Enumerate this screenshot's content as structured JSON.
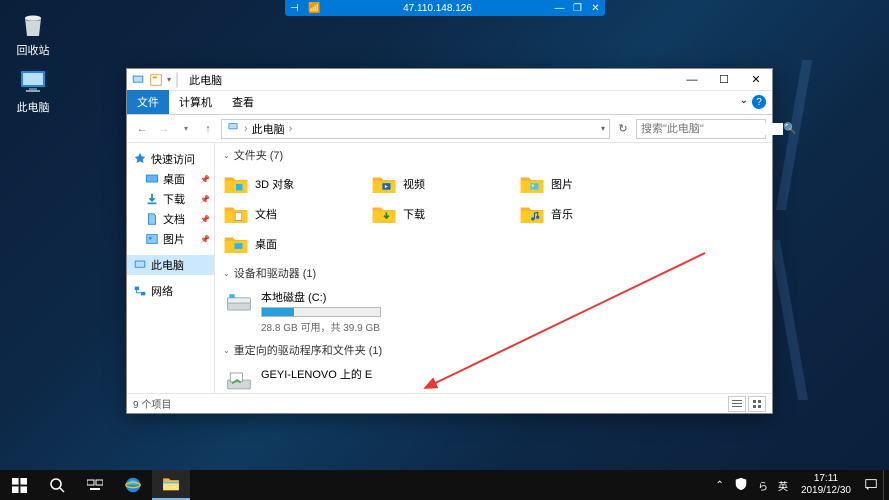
{
  "remote": {
    "ip": "47.110.148.126"
  },
  "desktop": {
    "recycle": "回收站",
    "thispc": "此电脑"
  },
  "explorer": {
    "title": "此电脑",
    "tabs": {
      "file": "文件",
      "computer": "计算机",
      "view": "查看"
    },
    "path": {
      "root": "此电脑",
      "sep": "›"
    },
    "search_placeholder": "搜索\"此电脑\"",
    "nav": {
      "quick": "快速访问",
      "desktop": "桌面",
      "downloads": "下载",
      "documents": "文档",
      "pictures": "图片",
      "thispc": "此电脑",
      "network": "网络"
    },
    "sections": {
      "folders": "文件夹 (7)",
      "drives": "设备和驱动器 (1)",
      "redirected": "重定向的驱动程序和文件夹 (1)"
    },
    "folders": {
      "objects3d": "3D 对象",
      "videos": "视频",
      "pictures": "图片",
      "documents": "文档",
      "downloads": "下载",
      "music": "音乐",
      "desktop": "桌面"
    },
    "drive": {
      "name": "本地磁盘 (C:)",
      "status": "28.8 GB 可用，共 39.9 GB",
      "used_pct": 27
    },
    "redirected_item": "GEYI-LENOVO 上的 E",
    "status": "9 个项目"
  },
  "taskbar": {
    "ime_lang": "英",
    "ime_mode": "ら",
    "time": "17:11",
    "date": "2019/12/30"
  }
}
